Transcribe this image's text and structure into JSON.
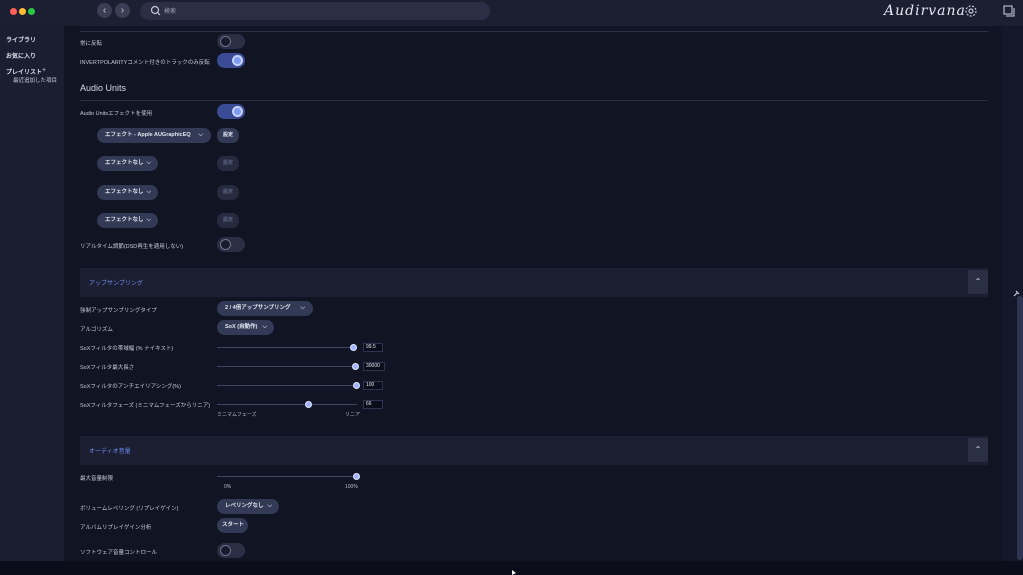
{
  "app": {
    "logo_text": "Audirvana",
    "search_placeholder": "検索",
    "colors": {
      "accent": "#6f8df0",
      "toggle_on": "#3b4b96",
      "background": "#111523"
    }
  },
  "sidebar": {
    "library": "ライブラリ",
    "favorites": "お気に入り",
    "playlists": "プレイリスト",
    "playlists_add": "+",
    "recently_added": "最近追加した項目"
  },
  "general": {
    "invert_always": "常に反転",
    "invert_comment": "INVERTPOLARITYコメント付きのトラックのみ反転",
    "invert_always_on": false,
    "invert_comment_on": true
  },
  "audio_units": {
    "title": "Audio Units",
    "use_label": "Audio Unitsエフェクトを使用",
    "use_on": true,
    "effects": [
      "エフェクト - Apple AUGraphicEQ",
      "エフェクトなし",
      "エフェクトなし",
      "エフェクトなし"
    ],
    "settings_label": "設定",
    "realtime_label": "リアルタイム調節(DSD再生を適用しない)",
    "realtime_on": false
  },
  "upsampling": {
    "title": "アップサンプリング",
    "collapse_glyph": "⌃",
    "type_label": "強制アップサンプリングタイプ",
    "type_value": "2 / 4倍アップサンプリング",
    "algorithm_label": "アルゴリズム",
    "algorithm_value": "SoX (自動作)",
    "sliders": [
      {
        "label": "SoXフィルタの帯域幅 (% ナイキスト)",
        "value": "99.5",
        "fraction": 0.98
      },
      {
        "label": "SoXフィルタ最大長さ",
        "value": "30000",
        "fraction": 0.99
      },
      {
        "label": "SoXフィルタのアンチエイリアシング(%)",
        "value": "100",
        "fraction": 1.0
      },
      {
        "label": "SoXフィルタフェーズ (ミニマムフェーズからリニア)",
        "value": "66",
        "fraction": 0.66
      }
    ],
    "phase_min": "ミニマムフェーズ",
    "phase_max": "リニア"
  },
  "audio_volume": {
    "title": "オーディオ音量",
    "collapse_glyph": "⌃",
    "max_label": "最大音量制限",
    "max_fraction": 1.0,
    "min_text": "0%",
    "max_text": "100%",
    "leveling_label": "ボリュームレベリング (リプレイゲイン)",
    "leveling_value": "レベリングなし",
    "album_label": "アルバムリプレイゲイン分析",
    "start_label": "スタート",
    "software_label": "ソフトウェア音量コントロール",
    "software_on": false
  }
}
